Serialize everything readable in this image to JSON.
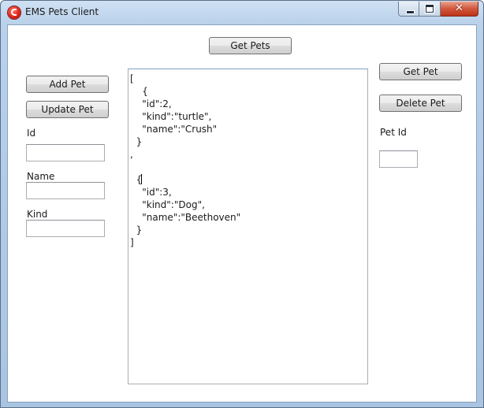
{
  "window": {
    "title": "EMS Pets Client",
    "close_symbol": "✕"
  },
  "buttons": {
    "get_pets": "Get Pets",
    "add_pet": "Add Pet",
    "update_pet": "Update Pet",
    "get_pet": "Get Pet",
    "delete_pet": "Delete Pet"
  },
  "fields": {
    "id_label": "Id",
    "id_value": "",
    "name_label": "Name",
    "name_value": "",
    "kind_label": "Kind",
    "kind_value": "",
    "pet_id_label": "Pet Id",
    "pet_id_value": ""
  },
  "output": {
    "text_before_caret": "[\n    {\n    \"id\":2,\n    \"kind\":\"turtle\",\n    \"name\":\"Crush\"\n  }\n,\n\n  {",
    "text_after_caret": "\n    \"id\":3,\n    \"kind\":\"Dog\",\n    \"name\":\"Beethoven\"\n  }\n]"
  }
}
